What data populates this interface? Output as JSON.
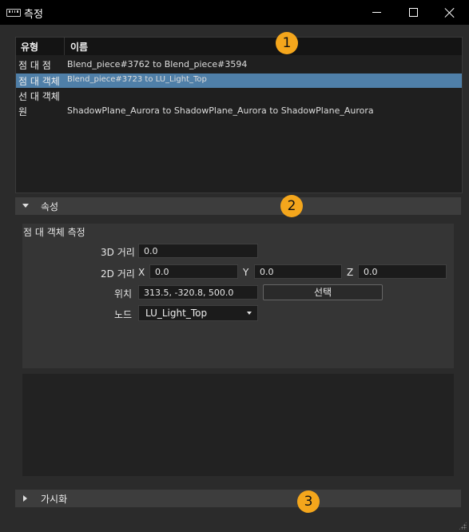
{
  "window": {
    "title": "측정",
    "icon": "ruler-icon",
    "controls": [
      "minimize-icon",
      "maximize-icon",
      "close-icon"
    ]
  },
  "measurements": {
    "columns": [
      "유형",
      "이름"
    ],
    "rows": [
      {
        "type": "점 대 점",
        "name": "Blend_piece#3762  to  Blend_piece#3594",
        "selected": false
      },
      {
        "type": "점 대 객체",
        "name": "Blend_piece#3723  to  LU_Light_Top",
        "selected": true
      },
      {
        "type": "선 대 객체",
        "name": "",
        "selected": false
      },
      {
        "type": "원",
        "name": "ShadowPlane_Aurora  to  ShadowPlane_Aurora  to  ShadowPlane_Aurora",
        "selected": false
      }
    ]
  },
  "properties": {
    "header": "속성",
    "title": "점 대 객체 측정",
    "dist3d_label": "3D 거리",
    "dist3d_value": "0.0",
    "dist2d_label": "2D 거리",
    "x_label": "X",
    "x_value": "0.0",
    "y_label": "Y",
    "y_value": "0.0",
    "z_label": "Z",
    "z_value": "0.0",
    "position_label": "위치",
    "position_value": "313.5, -320.8, 500.0",
    "select_button": "선택",
    "node_label": "노드",
    "node_value": "LU_Light_Top"
  },
  "visualization": {
    "header": "가시화"
  },
  "badges": [
    "1",
    "2",
    "3"
  ],
  "colors": {
    "selection": "#4f7fa8",
    "badge": "#f4a61c"
  }
}
